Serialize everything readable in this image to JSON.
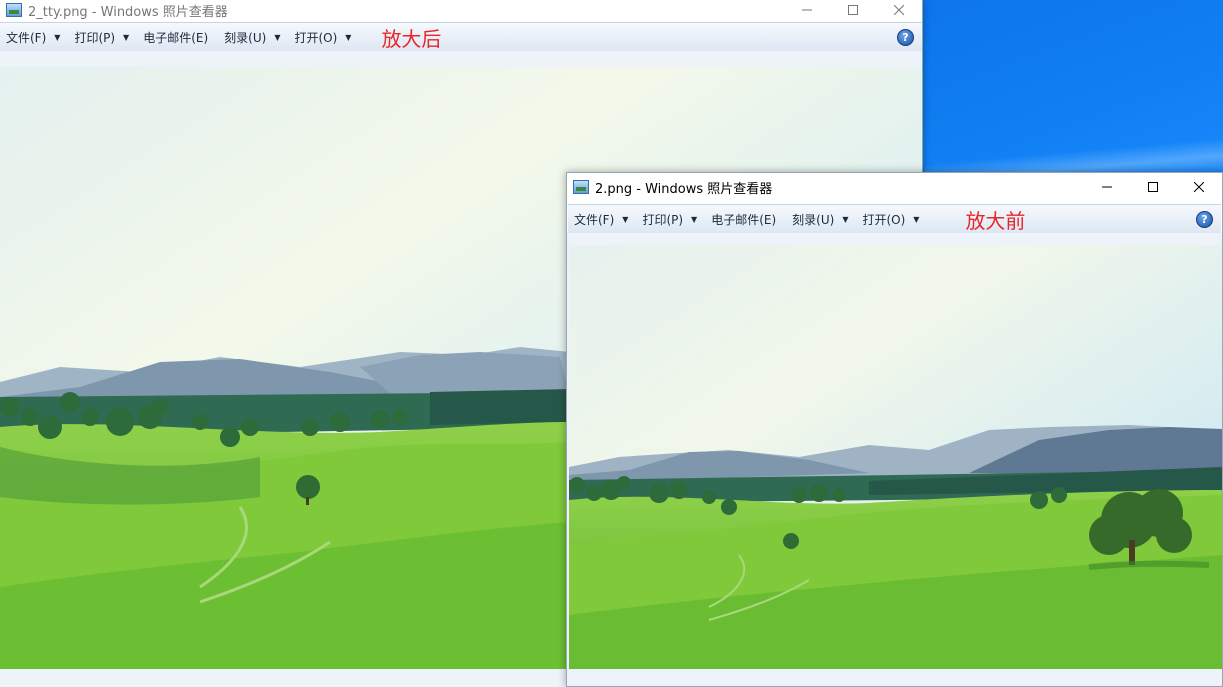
{
  "desktop": {
    "accent": "#0a64e0"
  },
  "window_back": {
    "title": "2_tty.png - Windows 照片查看器",
    "menu": [
      {
        "label": "文件(F)",
        "has_arrow": true
      },
      {
        "label": "打印(P)",
        "has_arrow": true
      },
      {
        "label": "电子邮件(E)",
        "has_arrow": false
      },
      {
        "label": "刻录(U)",
        "has_arrow": true
      },
      {
        "label": "打开(O)",
        "has_arrow": true
      }
    ],
    "annotation": "放大后",
    "help": "?"
  },
  "window_front": {
    "title": "2.png - Windows 照片查看器",
    "menu": [
      {
        "label": "文件(F)",
        "has_arrow": true
      },
      {
        "label": "打印(P)",
        "has_arrow": true
      },
      {
        "label": "电子邮件(E)",
        "has_arrow": false
      },
      {
        "label": "刻录(U)",
        "has_arrow": true
      },
      {
        "label": "打开(O)",
        "has_arrow": true
      }
    ],
    "annotation": "放大前",
    "help": "?"
  },
  "colors": {
    "annotation_red": "#e8262a",
    "menubar_top": "#f6f9fd",
    "menubar_bottom": "#dde7f3"
  }
}
